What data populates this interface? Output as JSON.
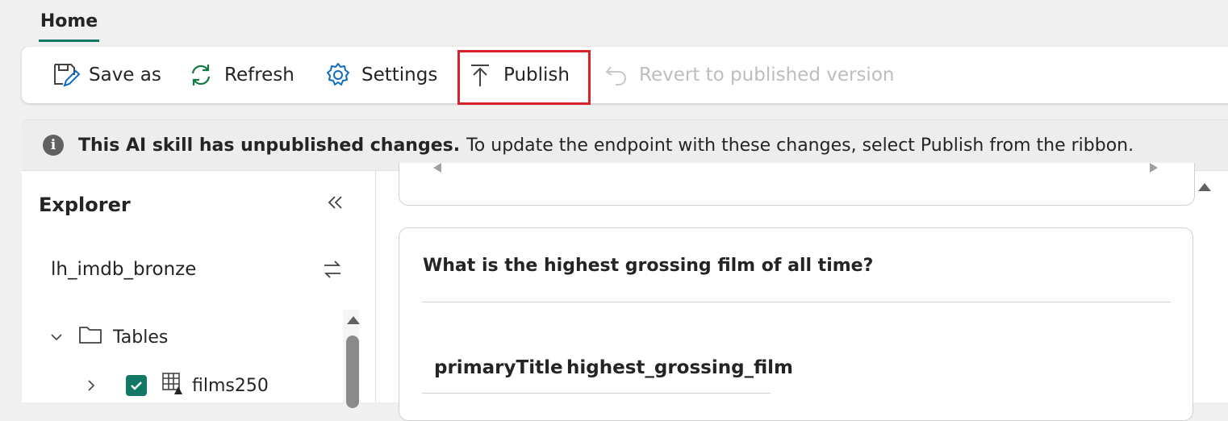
{
  "tabs": {
    "home": "Home"
  },
  "ribbon": {
    "save_as": "Save as",
    "refresh": "Refresh",
    "settings": "Settings",
    "publish": "Publish",
    "revert": "Revert to published version"
  },
  "message_bar": {
    "bold": "This AI skill has unpublished changes.",
    "text": "To update the endpoint with these changes, select Publish from the ribbon."
  },
  "explorer": {
    "title": "Explorer",
    "lakehouse": "lh_imdb_bronze",
    "tables_label": "Tables",
    "table_item": "films250"
  },
  "main": {
    "question": "What is the highest grossing film of all time?",
    "columns": [
      "primaryTitle",
      "highest_grossing_film"
    ]
  },
  "colors": {
    "accent": "#117865",
    "highlight": "#d9232a",
    "icon_blue": "#0f6cbd",
    "icon_green": "#107c41"
  }
}
